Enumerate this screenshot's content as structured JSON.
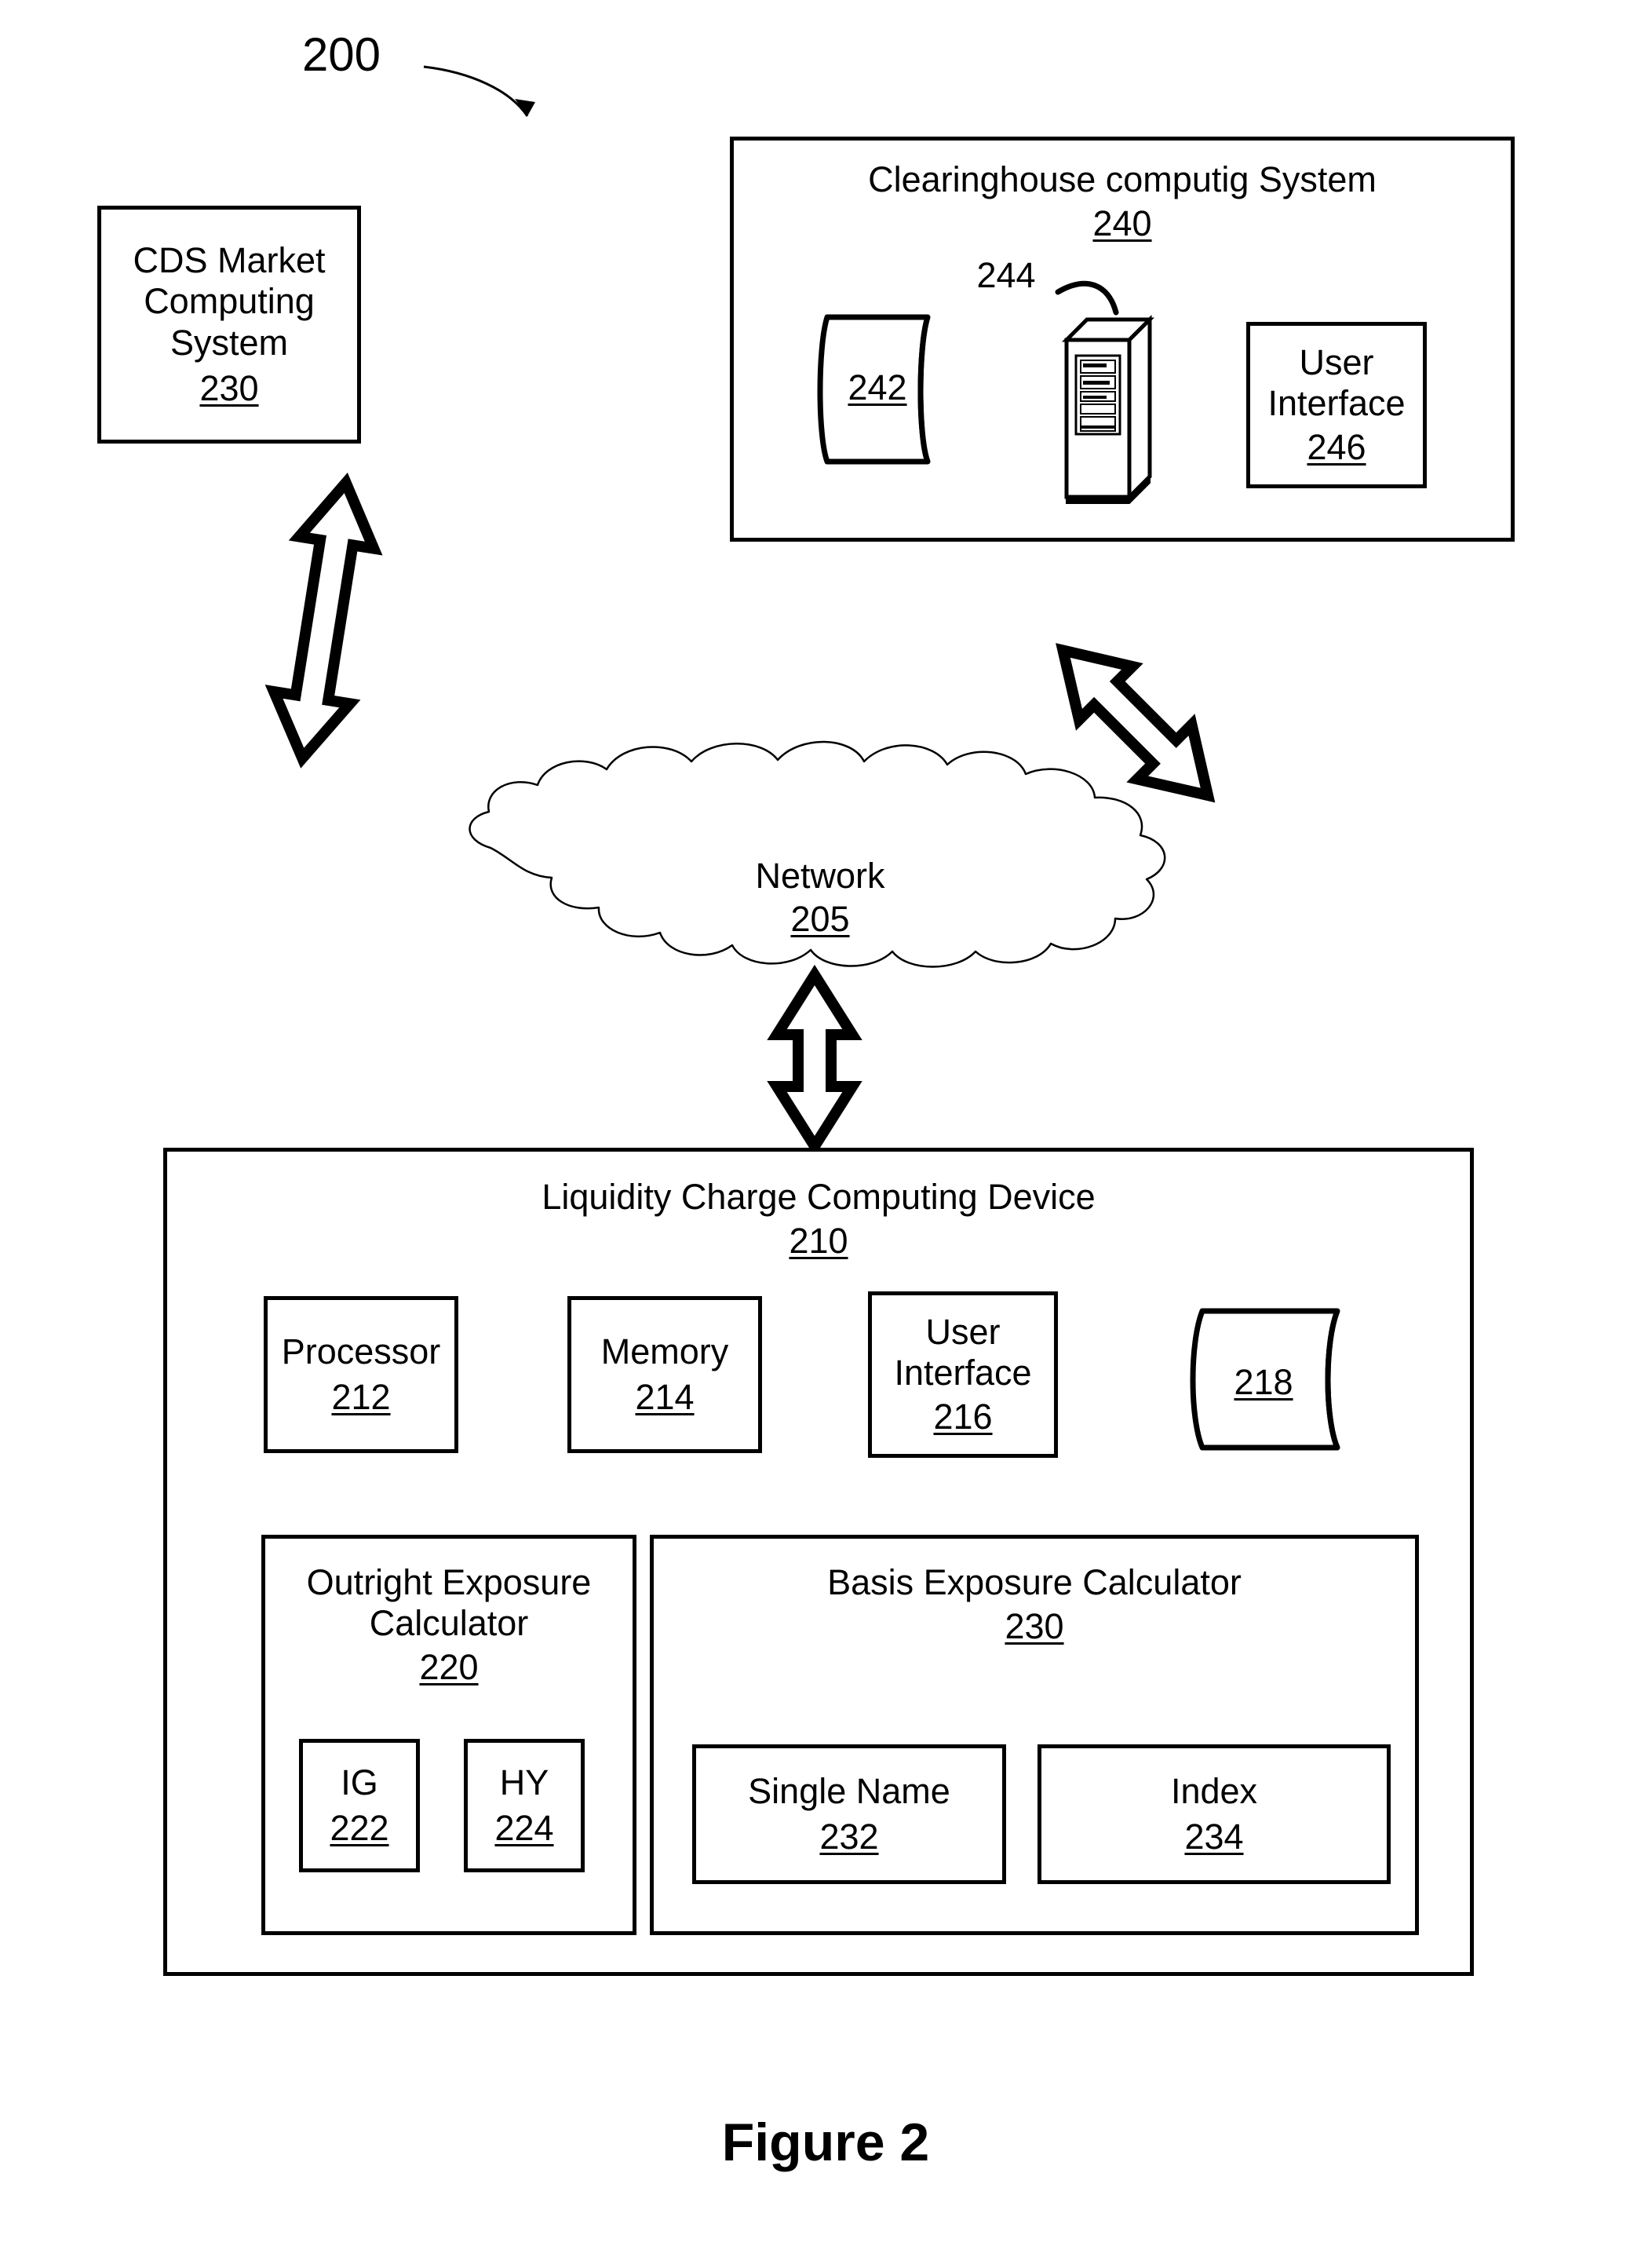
{
  "figure": {
    "caption": "Figure 2",
    "diagram_ref": "200"
  },
  "cds_market": {
    "title": "CDS Market\nComputing System",
    "ref": "230"
  },
  "clearinghouse": {
    "title": "Clearinghouse computig System",
    "ref": "240",
    "server_ref": "244",
    "database_ref": "242",
    "user_interface": {
      "title": "User\nInterface",
      "ref": "246"
    }
  },
  "network": {
    "title": "Network",
    "ref": "205"
  },
  "liquidity_device": {
    "title": "Liquidity Charge Computing Device",
    "ref": "210",
    "components": [
      {
        "title": "Processor",
        "ref": "212"
      },
      {
        "title": "Memory",
        "ref": "214"
      },
      {
        "title": "User\nInterface",
        "ref": "216"
      }
    ],
    "storage_ref": "218",
    "outright_calculator": {
      "title": "Outright Exposure\nCalculator",
      "ref": "220",
      "children": [
        {
          "title": "IG",
          "ref": "222"
        },
        {
          "title": "HY",
          "ref": "224"
        }
      ]
    },
    "basis_calculator": {
      "title": "Basis Exposure Calculator",
      "ref": "230",
      "children": [
        {
          "title": "Single Name",
          "ref": "232"
        },
        {
          "title": "Index",
          "ref": "234"
        }
      ]
    }
  },
  "colors": {
    "stroke": "#000000",
    "background": "#ffffff"
  }
}
